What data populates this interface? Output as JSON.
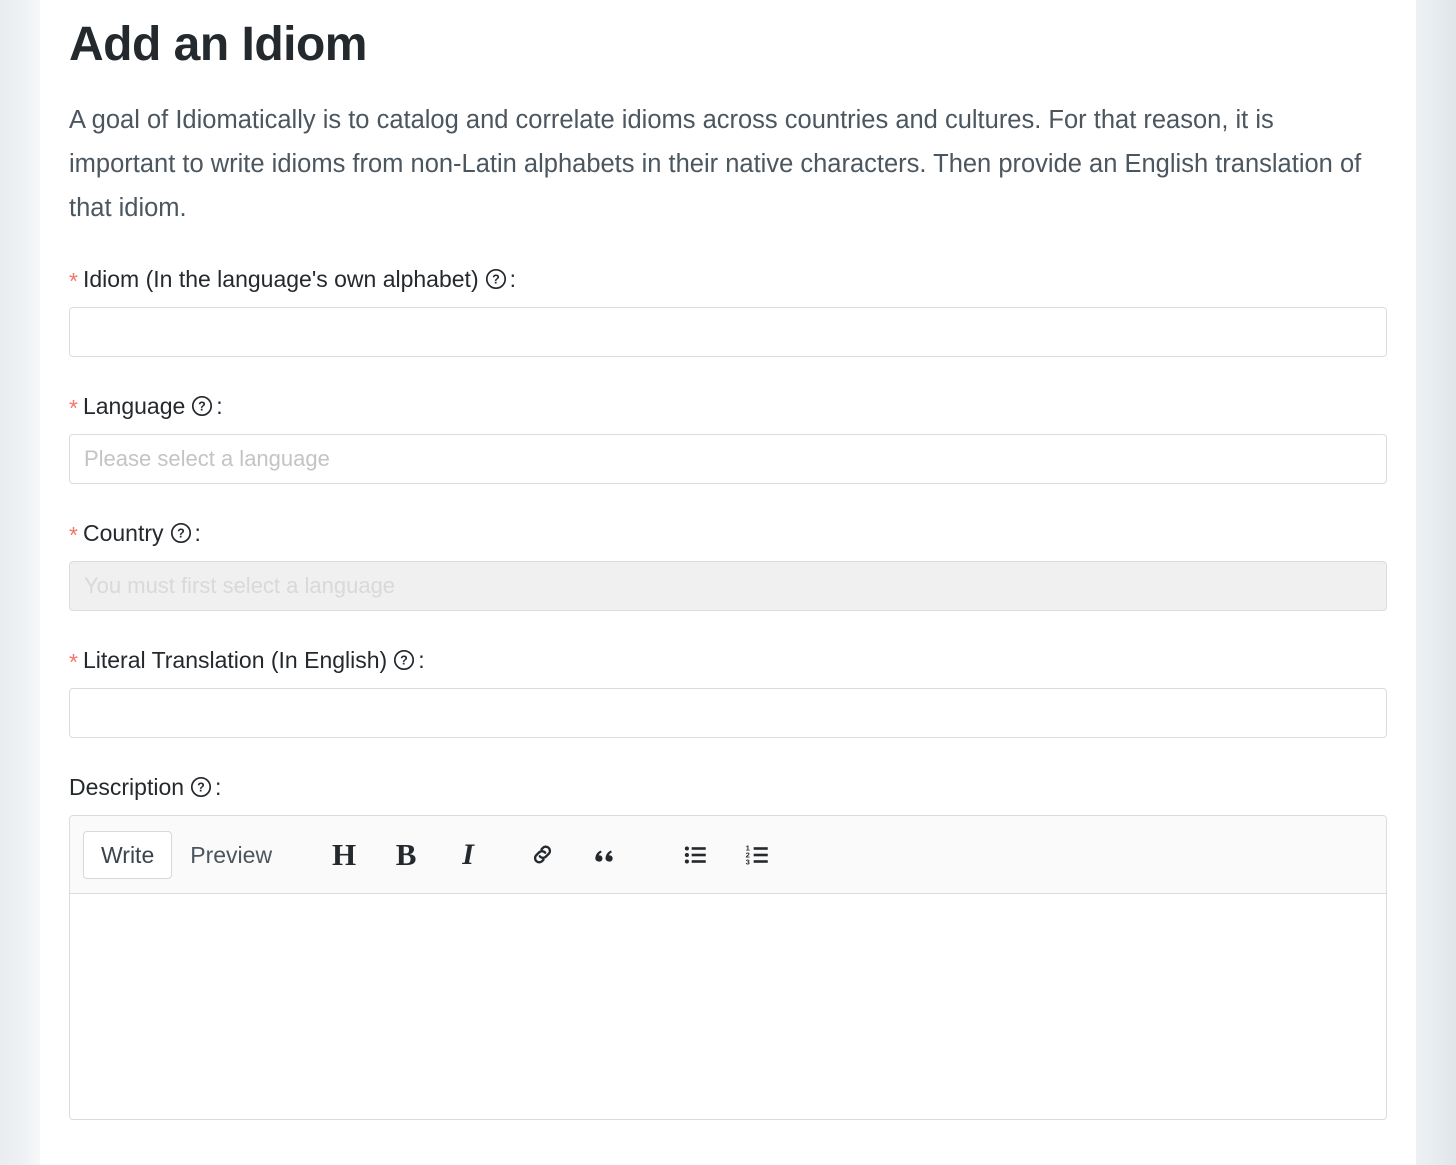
{
  "page": {
    "title": "Add an Idiom",
    "intro": "A goal of Idiomatically is to catalog and correlate idioms across countries and cultures. For that reason, it is important to write idioms from non-Latin alphabets in their native characters. Then provide an English translation of that idiom."
  },
  "colors": {
    "required_asterisk": "#f5756b",
    "text": "#24292e",
    "muted_text": "#4b565f",
    "placeholder": "#c2c4c6",
    "border": "#dcdcdc",
    "disabled_bg": "#f0f0f0",
    "toolbar_bg": "#fafafa",
    "page_bg": "#e4e9ed"
  },
  "symbols": {
    "required_marker": "*",
    "colon": ":",
    "help_icon": "question-circle-icon"
  },
  "fields": {
    "idiom": {
      "label": "Idiom (In the language's own alphabet)",
      "required": true,
      "value": "",
      "placeholder": "",
      "disabled": false,
      "help_icon": "question-circle-icon"
    },
    "language": {
      "label": "Language",
      "required": true,
      "value": "",
      "placeholder": "Please select a language",
      "disabled": false,
      "help_icon": "question-circle-icon"
    },
    "country": {
      "label": "Country",
      "required": true,
      "value": "",
      "placeholder": "You must first select a language",
      "disabled": true,
      "help_icon": "question-circle-icon"
    },
    "literal_translation": {
      "label": "Literal Translation (In English)",
      "required": true,
      "value": "",
      "placeholder": "",
      "disabled": false,
      "help_icon": "question-circle-icon"
    },
    "description": {
      "label": "Description",
      "required": false,
      "value": "",
      "placeholder": "",
      "help_icon": "question-circle-icon"
    }
  },
  "editor": {
    "tabs": [
      {
        "label": "Write",
        "active": true
      },
      {
        "label": "Preview",
        "active": false
      }
    ],
    "tools": [
      {
        "name": "heading-icon",
        "glyph": "H"
      },
      {
        "name": "bold-icon",
        "glyph": "B"
      },
      {
        "name": "italic-icon",
        "glyph": "I"
      },
      {
        "name": "link-icon",
        "glyph": "link"
      },
      {
        "name": "quote-icon",
        "glyph": "”"
      },
      {
        "name": "unordered-list-icon",
        "glyph": "bullet-list"
      },
      {
        "name": "ordered-list-icon",
        "glyph": "numbered-list"
      }
    ],
    "content": ""
  }
}
